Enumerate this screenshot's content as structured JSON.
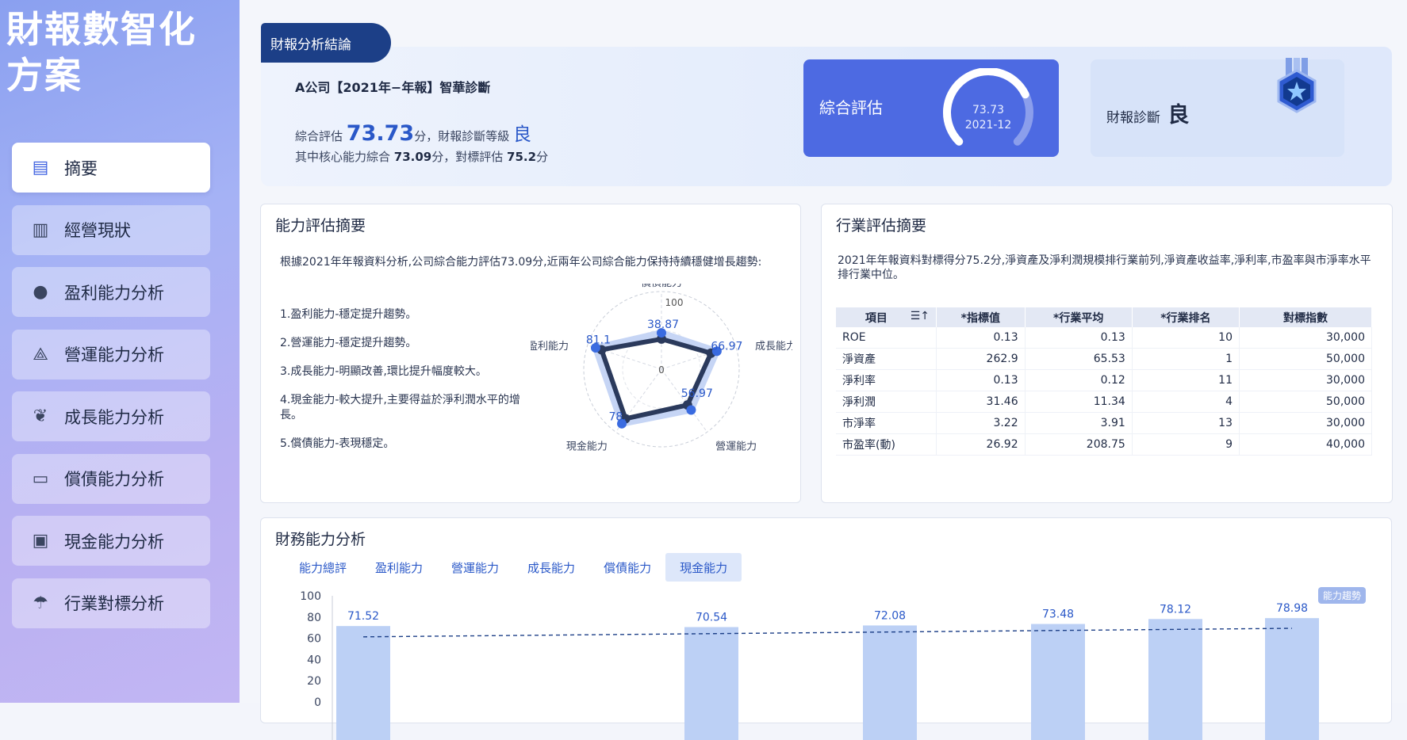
{
  "app": {
    "title": "財報數智化方案"
  },
  "sidebar": {
    "items": [
      {
        "label": "摘要",
        "icon": "document-icon",
        "active": true
      },
      {
        "label": "經營現狀",
        "icon": "dashboard-icon",
        "active": false
      },
      {
        "label": "盈利能力分析",
        "icon": "piggy-bank-icon",
        "active": false
      },
      {
        "label": "營運能力分析",
        "icon": "network-icon",
        "active": false
      },
      {
        "label": "成長能力分析",
        "icon": "leaf-icon",
        "active": false
      },
      {
        "label": "償債能力分析",
        "icon": "card-icon",
        "active": false
      },
      {
        "label": "現金能力分析",
        "icon": "wallet-icon",
        "active": false
      },
      {
        "label": "行業對標分析",
        "icon": "mushroom-icon",
        "active": false
      }
    ]
  },
  "conclusion": {
    "tag": "財報分析結論",
    "title": "A公司【2021年−年報】智華診斷",
    "line1_prefix": "綜合評估",
    "score": "73.73",
    "line1_mid": "分，財報診斷等級",
    "grade": "良",
    "line2_a": "其中核心能力綜合",
    "core_score": "73.09",
    "line2_b": "分，對標評估",
    "benchmark_score": "75.2",
    "line2_c": "分"
  },
  "eval_card": {
    "label": "綜合評估",
    "score": "73.73",
    "period": "2021-12",
    "progress": 0.7373
  },
  "diag_card": {
    "label": "財報診斷",
    "grade": "良"
  },
  "ability_summary": {
    "title": "能力評估摘要",
    "intro": "根據2021年年報資料分析,公司綜合能力評估73.09分,近兩年公司綜合能力保持持續穩健增長趨勢:",
    "points": [
      "1.盈利能力-穩定提升趨勢。",
      "2.營運能力-穩定提升趨勢。",
      "3.成長能力-明顯改善,環比提升幅度較大。",
      "4.現金能力-較大提升,主要得益於淨利潤水平的增長。",
      "5.償債能力-表現穩定。"
    ],
    "radar": {
      "axes": [
        "償債能力",
        "成長能力",
        "營運能力",
        "現金能力",
        "盈利能力"
      ],
      "max": 100,
      "center_label": "0",
      "max_label": "100",
      "values": [
        38.87,
        66.97,
        56.97,
        78.8,
        81.1
      ],
      "value_labels": [
        "38.87",
        "66.97",
        "56.97",
        "78.",
        "81.1"
      ]
    }
  },
  "industry_summary": {
    "title": "行業評估摘要",
    "intro": "2021年年報資料對標得分75.2分,淨資產及淨利潤規模排行業前列,淨資產收益率,淨利率,市盈率與市淨率水平排行業中位。",
    "columns": [
      "項目",
      "*指標值",
      "*行業平均",
      "*行業排名",
      "對標指數"
    ],
    "rows": [
      [
        "ROE",
        "0.13",
        "0.13",
        "10",
        "30,000"
      ],
      [
        "淨資產",
        "262.9",
        "65.53",
        "1",
        "50,000"
      ],
      [
        "淨利率",
        "0.13",
        "0.12",
        "11",
        "30,000"
      ],
      [
        "淨利潤",
        "31.46",
        "11.34",
        "4",
        "50,000"
      ],
      [
        "市淨率",
        "3.22",
        "3.91",
        "13",
        "30,000"
      ],
      [
        "市盈率(動)",
        "26.92",
        "208.75",
        "9",
        "40,000"
      ]
    ],
    "sort_icon": "sort-icon"
  },
  "financial_analysis": {
    "title": "財務能力分析",
    "tabs": [
      "能力總評",
      "盈利能力",
      "營運能力",
      "成長能力",
      "償債能力",
      "現金能力"
    ],
    "active_tab": 5,
    "trend_chip": "能力趨勢"
  },
  "chart_data": {
    "type": "bar",
    "ylim": [
      0,
      100
    ],
    "yticks": [
      "100",
      "80",
      "60",
      "40",
      "20",
      "0"
    ],
    "values": [
      71.52,
      70.54,
      72.08,
      73.48,
      78.12,
      78.98
    ],
    "value_labels": [
      "71.52",
      "70.54",
      "72.08",
      "73.48",
      "78.12",
      "78.98"
    ],
    "trendline": true,
    "colors": {
      "bar": "#bcd0f5",
      "line": "#1c3f87",
      "label": "#2a58c8"
    }
  }
}
